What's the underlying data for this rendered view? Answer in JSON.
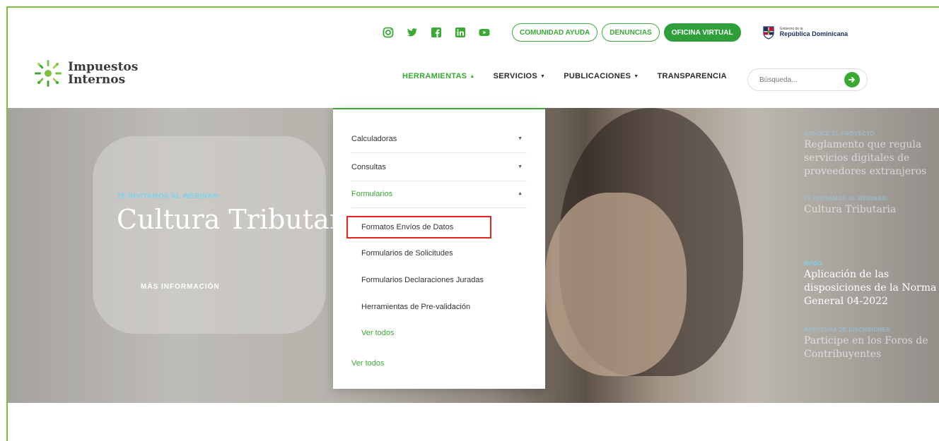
{
  "topbar": {
    "social": [
      {
        "name": "instagram-icon"
      },
      {
        "name": "twitter-icon"
      },
      {
        "name": "facebook-icon"
      },
      {
        "name": "linkedin-icon"
      },
      {
        "name": "youtube-icon"
      }
    ],
    "buttons": [
      "COMUNIDAD AYUDA",
      "DENUNCIAS",
      "OFICINA VIRTUAL"
    ],
    "gov_small": "Gobierno de la",
    "gov_big": "República Dominicana"
  },
  "logo": {
    "line1": "Impuestos",
    "line2": "Internos"
  },
  "nav": {
    "items": [
      "HERRAMIENTAS",
      "SERVICIOS",
      "PUBLICACIONES",
      "TRANSPARENCIA"
    ],
    "search_placeholder": "Búsqueda..."
  },
  "hero": {
    "kicker": "TE INVITAMOS AL WEBINAR:",
    "title": "Cultura Tributaria",
    "cta": "MÁS INFORMACIÓN"
  },
  "side": [
    {
      "kicker": "CONOCE EL PROYECTO:",
      "text": "Reglamento que regula servicios digitales de proveedores extranjeros"
    },
    {
      "kicker": "TE INVITAMOS AL WEBINAR:",
      "text": "Cultura Tributaria"
    },
    {
      "kicker": "AVISO",
      "text": "Aplicación de las disposiciones de la Norma General 04-2022"
    },
    {
      "kicker": "APERTURA DE DISCUSIONES",
      "text": "Participe en los Foros de Contribuyentes"
    }
  ],
  "dropdown": {
    "sections": [
      "Calculadoras",
      "Consultas",
      "Formularios"
    ],
    "sub_items": [
      "Formatos Envíos de Datos",
      "Formularios de Solicitudes",
      "Formularios Declaraciones Juradas",
      "Herramientas de Pre-validación",
      "Ver todos"
    ],
    "footer": "Ver todos"
  },
  "colors": {
    "brand_green": "#3aaa35",
    "highlight_red": "#e3261f",
    "kicker_blue": "#7cd3ee"
  }
}
